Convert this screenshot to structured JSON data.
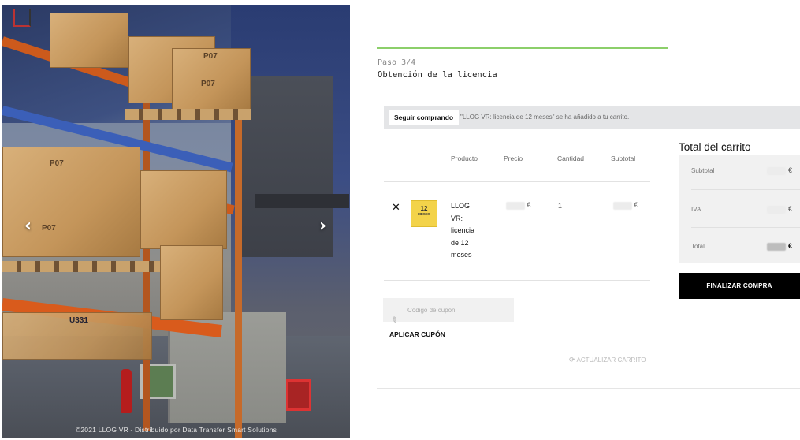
{
  "hero": {
    "footer": "©2021 LLOG VR - Distribuido por Data Transfer Smart Solutions",
    "prev_icon": "chevron-left-icon",
    "next_icon": "chevron-right-icon",
    "box_code": "P07",
    "rack_code": "U331"
  },
  "checkout_step": {
    "step": "Paso 3/4",
    "title": "Obtención de la licencia",
    "progress": 0.75
  },
  "notice": {
    "button": "Seguir comprando",
    "message": "\"LLOG VR: licencia de 12 meses\" se ha añadido a tu carrito."
  },
  "cart": {
    "columns": [
      "Producto",
      "Precio",
      "Cantidad",
      "Subtotal"
    ],
    "item": {
      "name_lines": [
        "LLOG",
        "VR:",
        "licencia",
        "de 12",
        "meses"
      ],
      "thumb_big": "12",
      "thumb_small": "MESES",
      "price_currency": "€",
      "quantity": "1",
      "subtotal_currency": "€"
    },
    "coupon_placeholder": "Código de cupón",
    "apply_label": "APLICAR CUPÓN",
    "update_label": "ACTUALIZAR CARRITO"
  },
  "totals": {
    "title": "Total del carrito",
    "rows": [
      {
        "label": "Subtotal",
        "currency": "€"
      },
      {
        "label": "IVA",
        "currency": "€"
      },
      {
        "label": "Total",
        "currency": "€"
      }
    ],
    "checkout_label": "FINALIZAR COMPRA"
  },
  "colors": {
    "progress": "#8ccf6a",
    "checkout_bg": "#000000",
    "notice_bg": "#e4e5e7"
  }
}
